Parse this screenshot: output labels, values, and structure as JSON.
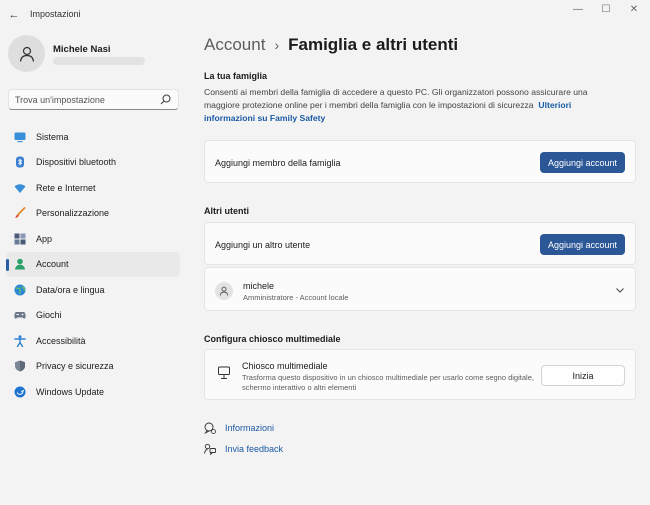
{
  "window": {
    "title": "Impostazioni",
    "back_glyph": "←",
    "minimize_glyph": "—",
    "maximize_glyph": "☐",
    "close_glyph": "✕"
  },
  "profile": {
    "name": "Michele Nasi"
  },
  "search": {
    "placeholder": "Trova un'impostazione"
  },
  "sidebar": {
    "items": [
      {
        "label": "Sistema",
        "icon": "monitor-icon"
      },
      {
        "label": "Dispositivi bluetooth",
        "icon": "bluetooth-icon"
      },
      {
        "label": "Rete e Internet",
        "icon": "wifi-icon"
      },
      {
        "label": "Personalizzazione",
        "icon": "brush-icon"
      },
      {
        "label": "App",
        "icon": "apps-icon"
      },
      {
        "label": "Account",
        "icon": "account-icon",
        "selected": true
      },
      {
        "label": "Data/ora e lingua",
        "icon": "globe-clock-icon"
      },
      {
        "label": "Giochi",
        "icon": "gamepad-icon"
      },
      {
        "label": "Accessibilità",
        "icon": "accessibility-icon"
      },
      {
        "label": "Privacy e sicurezza",
        "icon": "shield-icon"
      },
      {
        "label": "Windows Update",
        "icon": "windows-update-icon"
      }
    ]
  },
  "breadcrumb": {
    "parent": "Account",
    "separator": "›",
    "current": "Famiglia e altri utenti"
  },
  "family": {
    "title": "La tua famiglia",
    "description": "Consenti ai membri della famiglia di accedere a questo PC. Gli organizzatori possono assicurare una maggiore protezione online per i membri della famiglia con le impostazioni di sicurezza",
    "link": "Ulteriori informazioni su Family Safety",
    "add_label": "Aggiungi membro della famiglia",
    "add_button": "Aggiungi account"
  },
  "other_users": {
    "title": "Altri utenti",
    "add_label": "Aggiungi un altro utente",
    "add_button": "Aggiungi account",
    "user": {
      "name": "michele",
      "role": "Amministratore - Account locale"
    }
  },
  "kiosk": {
    "section_title": "Configura chiosco multimediale",
    "title": "Chiosco multimediale",
    "description": "Trasforma questo dispositivo in un chiosco multimediale per usarlo come segno digitale, schermo interattivo o altri elementi",
    "button": "Inizia"
  },
  "help": {
    "info": "Informazioni",
    "feedback": "Invia feedback"
  },
  "colors": {
    "accent": "#2b5797",
    "link": "#1b5aa5",
    "background": "#f3f3f3",
    "card": "#fbfbfb"
  }
}
